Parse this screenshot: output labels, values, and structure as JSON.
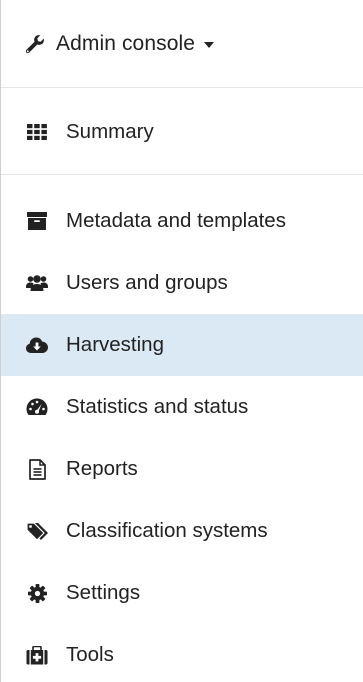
{
  "header": {
    "title": "Admin console",
    "icon": "wrench-icon"
  },
  "summary": {
    "label": "Summary",
    "icon": "grid-icon"
  },
  "menu": {
    "items": [
      {
        "label": "Metadata and templates",
        "icon": "archive-icon",
        "active": false
      },
      {
        "label": "Users and groups",
        "icon": "users-icon",
        "active": false
      },
      {
        "label": "Harvesting",
        "icon": "cloud-download-icon",
        "active": true
      },
      {
        "label": "Statistics and status",
        "icon": "dashboard-icon",
        "active": false
      },
      {
        "label": "Reports",
        "icon": "file-text-icon",
        "active": false
      },
      {
        "label": "Classification systems",
        "icon": "tags-icon",
        "active": false
      },
      {
        "label": "Settings",
        "icon": "cog-icon",
        "active": false
      },
      {
        "label": "Tools",
        "icon": "medkit-icon",
        "active": false
      }
    ]
  },
  "colors": {
    "active_background": "#dbe9f5",
    "divider": "#e6e6e6",
    "text": "#222222"
  }
}
